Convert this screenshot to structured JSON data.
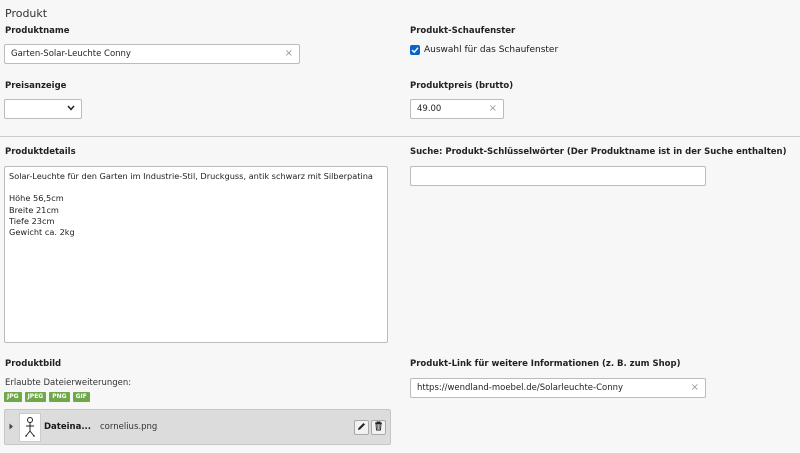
{
  "section_title": "Produkt",
  "fields": {
    "produktname": {
      "label": "Produktname",
      "value": "Garten-Solar-Leuchte Conny"
    },
    "schaufenster": {
      "label": "Produkt-Schaufenster",
      "checkbox_label": "Auswahl für das Schaufenster",
      "checked": true
    },
    "preisanzeige": {
      "label": "Preisanzeige",
      "value": ""
    },
    "produktpreis": {
      "label": "Produktpreis (brutto)",
      "value": "49.00"
    },
    "produktdetails": {
      "label": "Produktdetails",
      "value": "Solar-Leuchte für den Garten im Industrie-Stil, Druckguss, antik schwarz mit Silberpatina\n\nHöhe 56,5cm\nBreite 21cm\nTiefe 23cm\nGewicht ca. 2kg"
    },
    "suche": {
      "label": "Suche: Produkt-Schlüsselwörter (Der Produktname ist in der Suche enthalten)",
      "value": ""
    },
    "produktbild": {
      "label": "Produktbild",
      "allowed_label": "Erlaubte Dateierweiterungen:",
      "extensions": [
        "JPG",
        "JPEG",
        "PNG",
        "GIF"
      ],
      "file": {
        "name_label": "Dateina...",
        "filename": "cornelius.png"
      }
    },
    "produktlink": {
      "label": "Produkt-Link für weitere Informationen (z. B. zum Shop)",
      "value": "https://wendland-moebel.de/Solarleuchte-Conny"
    }
  },
  "colors": {
    "checkbox": "#0a66c4",
    "badge": "#6fa84a"
  }
}
